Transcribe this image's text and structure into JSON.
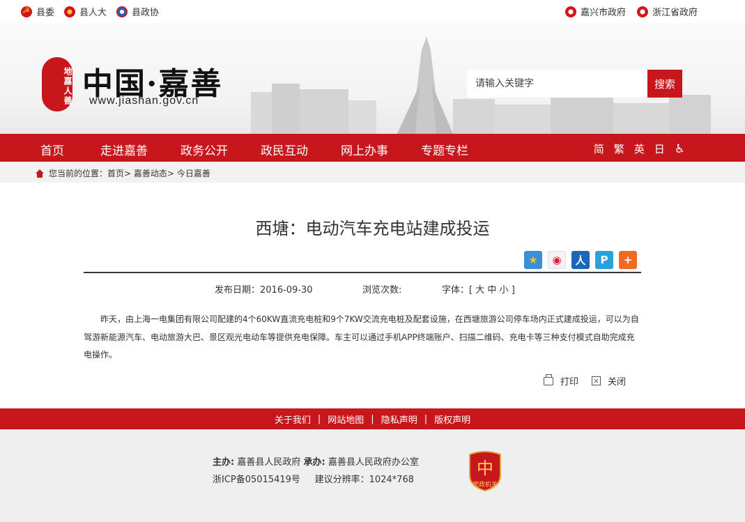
{
  "top_links": {
    "left": [
      {
        "label": "县委",
        "icon": "party-emblem-icon"
      },
      {
        "label": "县人大",
        "icon": "national-emblem-icon"
      },
      {
        "label": "县政协",
        "icon": "cppcc-emblem-icon"
      }
    ],
    "right": [
      {
        "label": "嘉兴市政府",
        "icon": "gov-emblem-icon"
      },
      {
        "label": "浙江省政府",
        "icon": "gov-emblem-icon"
      }
    ]
  },
  "header": {
    "seal_text": "地嘉人善",
    "site_title": "中国·嘉善",
    "site_url": "www.jiashan.gov.cn"
  },
  "search": {
    "placeholder": "请输入关键字",
    "button_label": "搜索"
  },
  "nav": {
    "items": [
      "首页",
      "走进嘉善",
      "政务公开",
      "政民互动",
      "网上办事",
      "专题专栏"
    ],
    "tools": [
      "简",
      "繁",
      "英",
      "日"
    ]
  },
  "breadcrumb": {
    "prefix": "您当前的位置：",
    "items": [
      "首页",
      "嘉善动态",
      "今日嘉善"
    ],
    "separator": ">"
  },
  "article": {
    "title": "西塘：电动汽车充电站建成投运",
    "publish_date": "发布日期：2016-09-30",
    "views_label": "浏览次数:",
    "font_label": "字体：[",
    "font_sizes": [
      "大",
      "中",
      "小"
    ],
    "font_close": "]",
    "body": "昨天，由上海一电集团有限公司配建的4个60KW直流充电桩和9个7KW交流充电桩及配套设施，在西塘旅游公司停车场内正式建成投运，可以为自驾游新能源汽车、电动旅游大巴、景区观光电动车等提供充电保障。车主可以通过手机APP终端账户、扫描二维码、充电卡等三种支付模式自助完成充电操作。",
    "print_label": "打印",
    "close_label": "关闭",
    "share_icons": [
      "qzone-share-icon",
      "weibo-share-icon",
      "renren-share-icon",
      "tencent-share-icon",
      "more-share-icon"
    ]
  },
  "footer": {
    "links": [
      "关于我们",
      "网站地图",
      "隐私声明",
      "版权声明"
    ],
    "separator": "|",
    "sponsor_label": "主办:",
    "sponsor": "嘉善县人民政府",
    "organizer_label": "承办:",
    "organizer": "嘉善县人民政府办公室",
    "icp": "浙ICP备05015419号",
    "resolution": "建议分辨率：1024*768",
    "badge_text": "党政机关"
  },
  "colors": {
    "brand_red": "#c8161d",
    "crumb_bg": "#f2f2f2",
    "footer_bg": "#efefef"
  }
}
